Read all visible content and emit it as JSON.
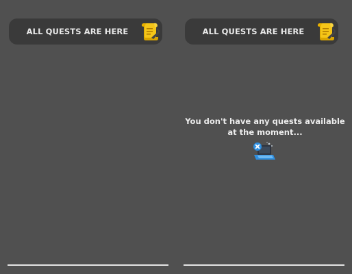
{
  "left_panel": {
    "header_label": "ALL QUESTS ARE HERE",
    "header_icon": "scroll-icon"
  },
  "right_panel": {
    "header_label": "ALL QUESTS ARE HERE",
    "header_icon": "scroll-icon",
    "empty_message_line1": "You don't have any quests available",
    "empty_message_line2": "at the moment...",
    "empty_icon": "laptop-icon"
  },
  "colors": {
    "background": "#505050",
    "header_bg": "#3a3a3a",
    "scroll_yellow": "#f5c518",
    "accent_blue": "#2f8fe0"
  }
}
